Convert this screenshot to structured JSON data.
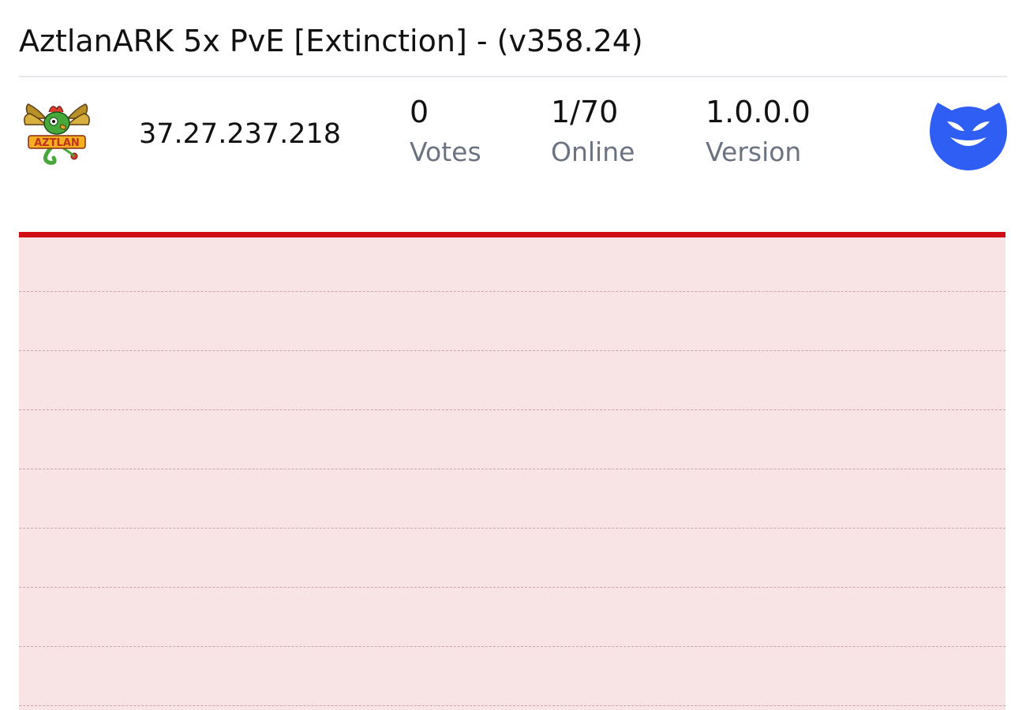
{
  "server": {
    "title": "AztlanARK 5x PvE [Extinction] - (v358.24)",
    "ip": "37.27.237.218",
    "logo_text": "AZTLAN",
    "logo_icon": "aztlan-quetzal-logo"
  },
  "stats": [
    {
      "value": "0",
      "label": "Votes"
    },
    {
      "value": "1/70",
      "label": "Online"
    },
    {
      "value": "1.0.0.0",
      "label": "Version"
    }
  ],
  "badge": {
    "icon": "blue-devil-face-icon",
    "color": "#2f5ef4"
  },
  "graph": {
    "line_color": "#d10d14",
    "fill_color": "#f8e3e5",
    "gridline_count": 8
  }
}
